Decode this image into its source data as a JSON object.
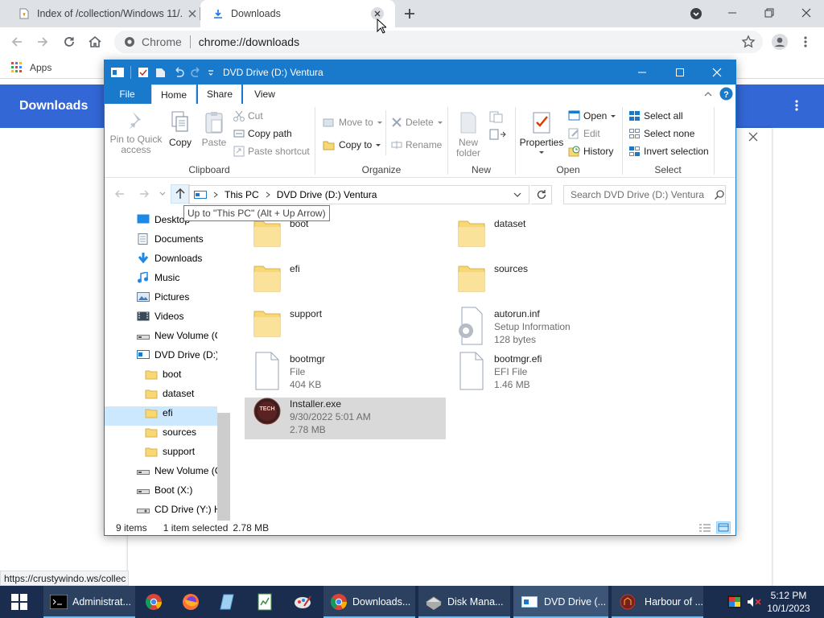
{
  "chrome": {
    "tabs": [
      {
        "title": "Index of /collection/Windows 11/..."
      },
      {
        "title": "Downloads"
      }
    ],
    "omnibox": {
      "site_label": "Chrome",
      "url": "chrome://downloads"
    },
    "bookmarks": {
      "apps_label": "Apps"
    },
    "downloads_page": {
      "title": "Downloads"
    },
    "status_url": "https://crustywindo.ws/collec"
  },
  "explorer": {
    "title": "DVD Drive (D:) Ventura",
    "ribbon_tabs": [
      "File",
      "Home",
      "Share",
      "View"
    ],
    "clipboard": {
      "pin_label": "Pin to Quick access",
      "copy_label": "Copy",
      "paste_label": "Paste",
      "cut_label": "Cut",
      "copy_path_label": "Copy path",
      "paste_shortcut_label": "Paste shortcut",
      "group": "Clipboard"
    },
    "organize": {
      "move_to": "Move to",
      "copy_to": "Copy to",
      "delete": "Delete",
      "rename": "Rename",
      "group": "Organize"
    },
    "new": {
      "new_folder": "New folder",
      "group": "New"
    },
    "open": {
      "properties": "Properties",
      "open": "Open",
      "edit": "Edit",
      "history": "History",
      "group": "Open"
    },
    "select": {
      "select_all": "Select all",
      "select_none": "Select none",
      "invert": "Invert selection",
      "group": "Select"
    },
    "address": {
      "crumbs": [
        "This PC",
        "DVD Drive (D:) Ventura"
      ],
      "search_placeholder": "Search DVD Drive (D:) Ventura"
    },
    "tooltip": "Up to \"This PC\" (Alt + Up Arrow)",
    "nav": [
      {
        "label": "Desktop",
        "icon": "desktop-icon"
      },
      {
        "label": "Documents",
        "icon": "documents-icon"
      },
      {
        "label": "Downloads",
        "icon": "downloads-icon"
      },
      {
        "label": "Music",
        "icon": "music-icon"
      },
      {
        "label": "Pictures",
        "icon": "pictures-icon"
      },
      {
        "label": "Videos",
        "icon": "videos-icon"
      },
      {
        "label": "New Volume (C",
        "icon": "drive-icon"
      },
      {
        "label": "DVD Drive (D:)",
        "icon": "dvd-drive-icon"
      },
      {
        "label": "boot",
        "icon": "folder-icon"
      },
      {
        "label": "dataset",
        "icon": "folder-icon"
      },
      {
        "label": "efi",
        "icon": "folder-icon"
      },
      {
        "label": "sources",
        "icon": "folder-icon"
      },
      {
        "label": "support",
        "icon": "folder-icon"
      },
      {
        "label": "New Volume (C",
        "icon": "drive-icon"
      },
      {
        "label": "Boot (X:)",
        "icon": "drive-icon"
      },
      {
        "label": "CD Drive (Y:) H",
        "icon": "cd-drive-icon"
      }
    ],
    "items": [
      {
        "name": "boot",
        "type": "folder"
      },
      {
        "name": "dataset",
        "type": "folder"
      },
      {
        "name": "efi",
        "type": "folder"
      },
      {
        "name": "sources",
        "type": "folder"
      },
      {
        "name": "support",
        "type": "folder"
      },
      {
        "name": "autorun.inf",
        "type": "setup",
        "line2": "Setup Information",
        "line3": "128 bytes"
      },
      {
        "name": "bootmgr",
        "type": "file",
        "line2": "File",
        "line3": "404 KB"
      },
      {
        "name": "bootmgr.efi",
        "type": "file",
        "line2": "EFI File",
        "line3": "1.46 MB"
      },
      {
        "name": "Installer.exe",
        "type": "exe",
        "line2": "9/30/2022 5:01 AM",
        "line3": "2.78 MB",
        "icon_text": "TECH"
      }
    ],
    "status": {
      "count": "9 items",
      "selected": "1 item selected",
      "size": "2.78 MB"
    }
  },
  "taskbar": {
    "items": [
      {
        "label": "Administrat..."
      },
      {
        "label": "Downloads..."
      },
      {
        "label": "Disk Mana..."
      },
      {
        "label": "DVD Drive (..."
      },
      {
        "label": "Harbour of ..."
      }
    ],
    "time": "5:12 PM",
    "date": "10/1/2023"
  }
}
